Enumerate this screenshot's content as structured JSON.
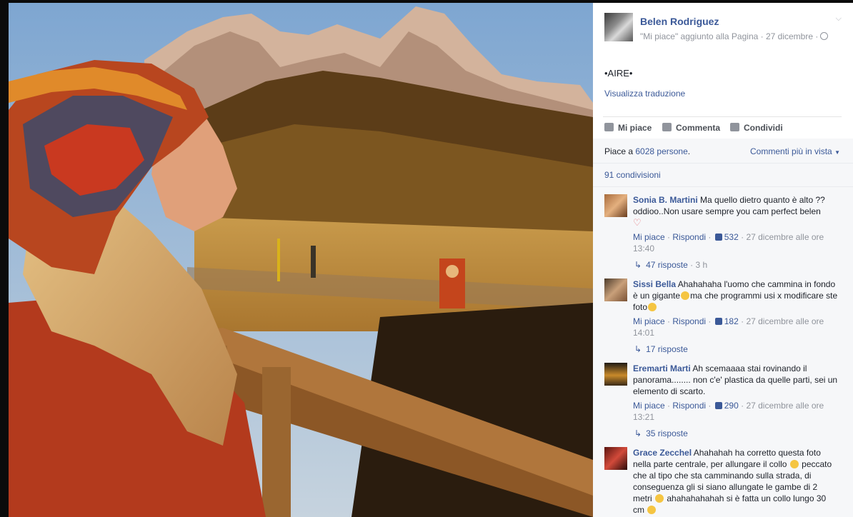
{
  "post": {
    "author": "Belen Rodriguez",
    "subline": "\"Mi piace\" aggiunto alla Pagina · 27 dicembre ·",
    "text": "•AIRE•",
    "translate": "Visualizza traduzione"
  },
  "actions": {
    "like": "Mi piace",
    "comment": "Commenta",
    "share": "Condividi"
  },
  "stats": {
    "likes_prefix": "Piace a ",
    "likes_count": "6028 persone",
    "likes_suffix": ".",
    "filter": "Commenti più in vista",
    "shares": "91 condivisioni"
  },
  "comments": [
    {
      "name": "Sonia B. Martini",
      "text": "Ma quello dietro quanto è alto ?? oddioo..Non usare sempre you cam perfect belen",
      "like": "Mi piace",
      "reply": "Rispondi",
      "likes": "532",
      "time": "27 dicembre alle ore 13:40",
      "replies": "47 risposte",
      "replies_age": "· 3 h"
    },
    {
      "name": "Sissi Bella",
      "text": "Ahahahaha l'uomo che cammina in fondo è un gigante",
      "text2": "ma che programmi usi x modificare ste foto",
      "like": "Mi piace",
      "reply": "Rispondi",
      "likes": "182",
      "time": "27 dicembre alle ore 14:01",
      "replies": "17 risposte"
    },
    {
      "name": "Eremarti Marti",
      "text": "Ah scemaaaa stai rovinando il panorama........ non c'e' plastica da quelle parti, sei un elemento di scarto.",
      "like": "Mi piace",
      "reply": "Rispondi",
      "likes": "290",
      "time": "27 dicembre alle ore 13:21",
      "replies": "35 risposte"
    },
    {
      "name": "Grace Zecchel",
      "text": "Ahahahah ha corretto questa foto nella parte centrale, per allungare il collo",
      "text2": "peccato che al tipo che sta camminando sulla strada, di conseguenza gli si siano allungate le gambe di 2 metri",
      "text3": "ahahahahahah si è fatta un collo lungo 30 cm"
    }
  ],
  "colors": {
    "link": "#3b5998",
    "meta": "#90949c",
    "panel_bg": "#f6f7f9"
  }
}
